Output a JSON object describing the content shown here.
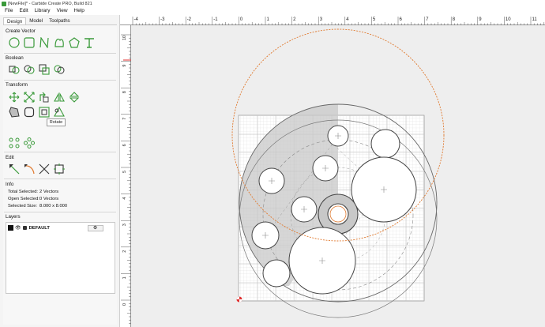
{
  "window": {
    "title": "[NewFile]* - Carbide Create PRO, Build 821"
  },
  "menu": [
    "File",
    "Edit",
    "Library",
    "View",
    "Help"
  ],
  "tabs": [
    {
      "label": "Design",
      "active": true
    },
    {
      "label": "Model",
      "active": false
    },
    {
      "label": "Toolpaths",
      "active": false
    }
  ],
  "sections": {
    "create_vector": "Create Vector",
    "boolean": "Boolean",
    "transform": "Transform",
    "edit": "Edit",
    "info": "Info",
    "layers": "Layers"
  },
  "tools": {
    "create_vector": [
      "circle-tool",
      "rectangle-tool",
      "polyline-tool",
      "curve-tool",
      "polygon-tool",
      "text-tool"
    ],
    "boolean": [
      "union-tool",
      "subtract-tool",
      "intersect-tool",
      "weld-tool"
    ],
    "transform_row1": [
      "move-tool",
      "scale-tool",
      "rotate-tool",
      "mirror-tool",
      "flip-tool"
    ],
    "transform_row2": [
      "offset-tool",
      "fillet-tool",
      "align-tool",
      "trim-tool"
    ],
    "transform_row3": [
      "array-tool",
      "circular-array-tool"
    ],
    "edit": [
      "node-edit-tool",
      "arc-tool",
      "cut-tool",
      "join-tool"
    ]
  },
  "tooltip": "Rotate",
  "info": {
    "total_selected_label": "Total Selected:",
    "total_selected_value": "2 Vectors",
    "open_selected_label": "Open Selected:",
    "open_selected_value": "0 Vectors",
    "selected_size_label": "Selected Size:",
    "selected_size_value": "8.000 x 8.000"
  },
  "layers": [
    {
      "name": "DEFAULT",
      "color": "#111111"
    }
  ],
  "colors": {
    "accent_green": "#3a9a3a",
    "selection_orange": "#e07a30",
    "grid": "#d2d2d2",
    "shade": "#c8c8c8"
  },
  "rulers": {
    "top": [
      "-4",
      "-3",
      "-2",
      "-1",
      "0",
      "1",
      "2",
      "3",
      "4",
      "5",
      "6",
      "7",
      "8",
      "9",
      "10",
      "11"
    ],
    "left": [
      "10",
      "9",
      "8",
      "7",
      "6",
      "5",
      "4",
      "3",
      "2",
      "1",
      "0"
    ]
  }
}
